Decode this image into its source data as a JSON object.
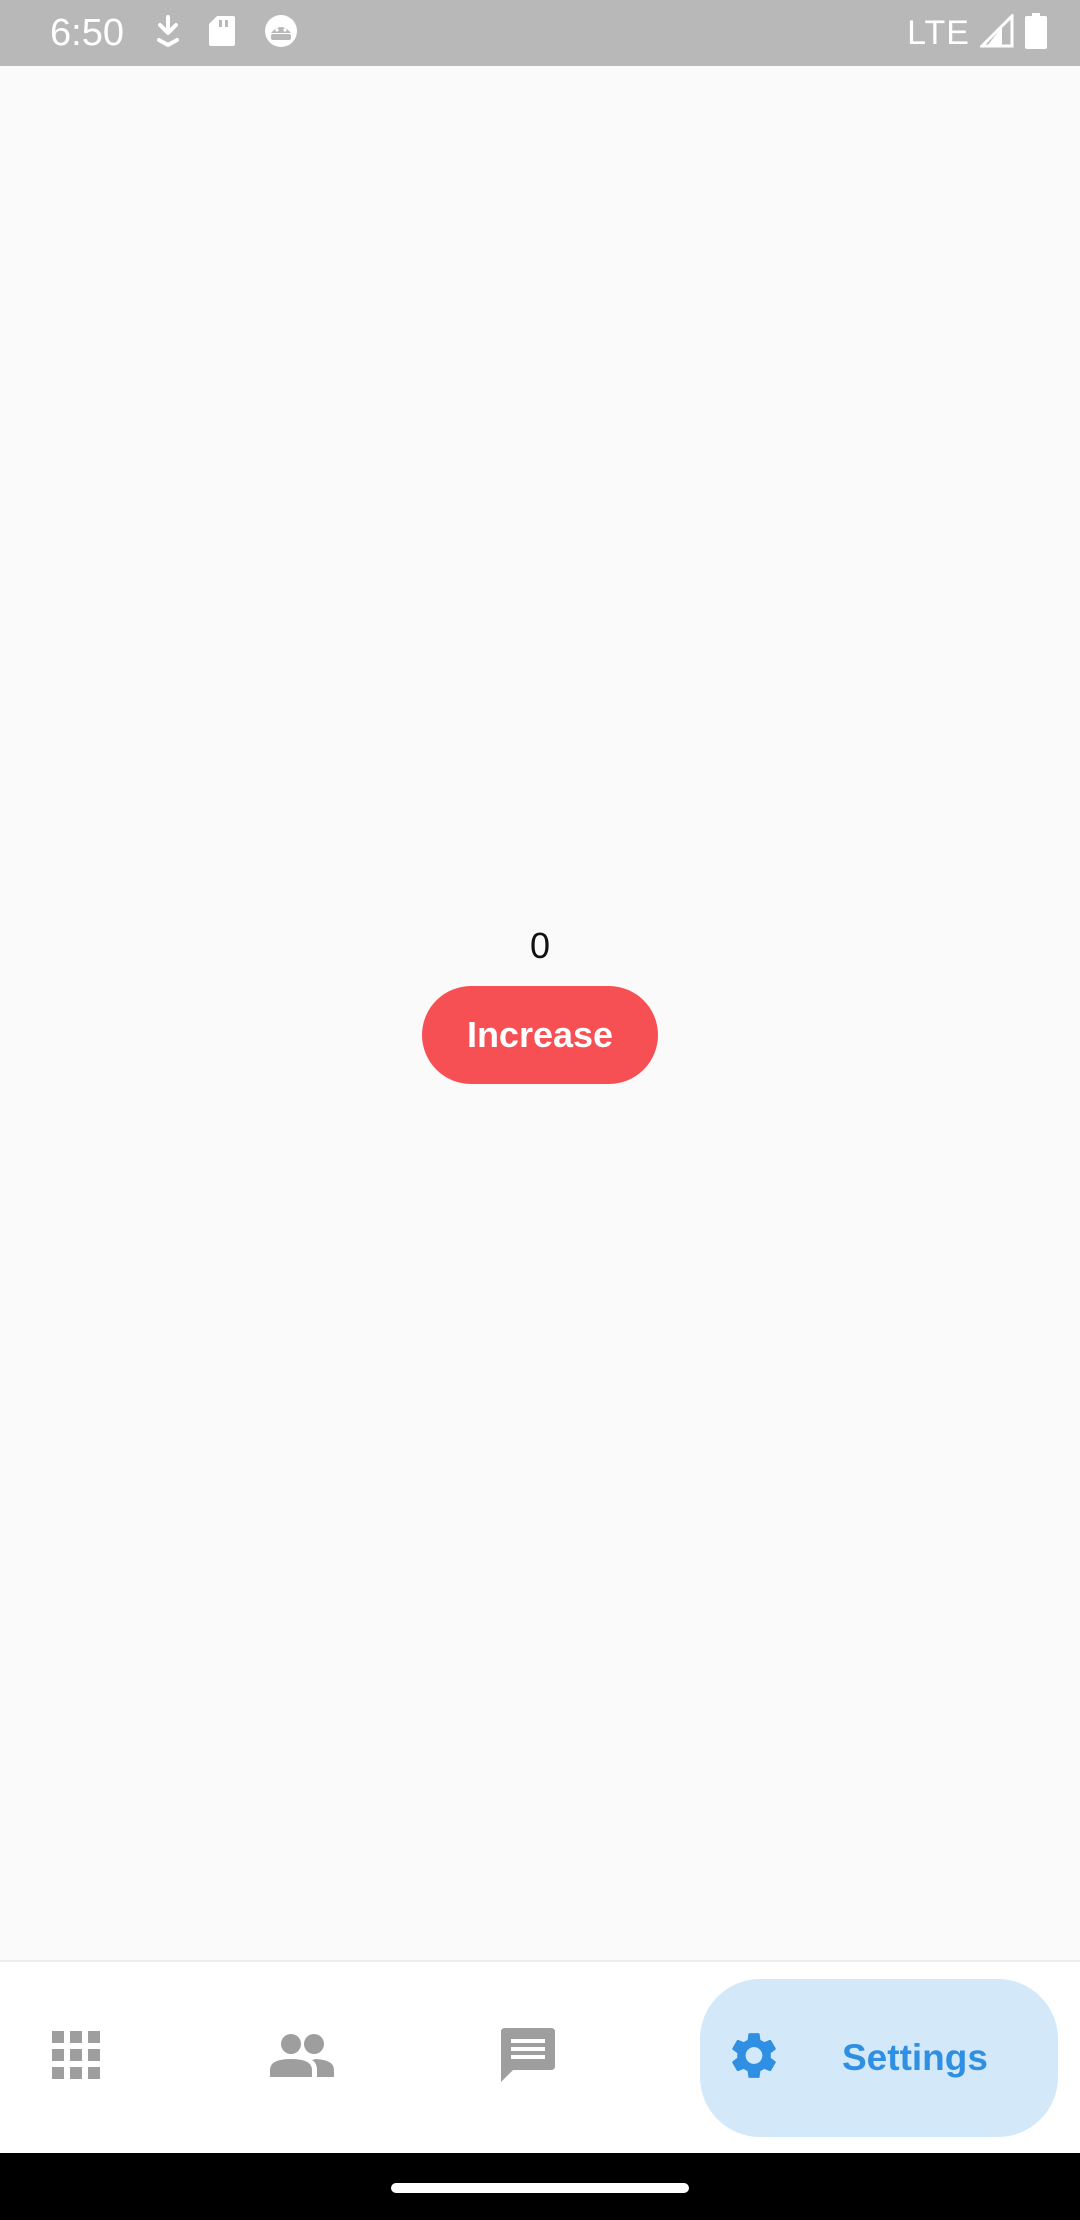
{
  "status_bar": {
    "time": "6:50",
    "network": "LTE",
    "icons_left": [
      "download-icon",
      "sd-card-icon",
      "android-debug-icon"
    ],
    "icons_right": [
      "signal-icon",
      "battery-icon"
    ]
  },
  "main": {
    "counter_value": "0",
    "increase_label": "Increase",
    "button_color": "#f75054"
  },
  "bottom_nav": {
    "items": [
      {
        "icon": "apps-grid-icon",
        "label": ""
      },
      {
        "icon": "people-icon",
        "label": ""
      },
      {
        "icon": "chat-icon",
        "label": ""
      },
      {
        "icon": "gear-icon",
        "label": "Settings",
        "selected": true
      }
    ],
    "selected_color": "#2f8fe2",
    "selected_background": "#d3e9fa",
    "inactive_color": "#9e9e9e"
  }
}
